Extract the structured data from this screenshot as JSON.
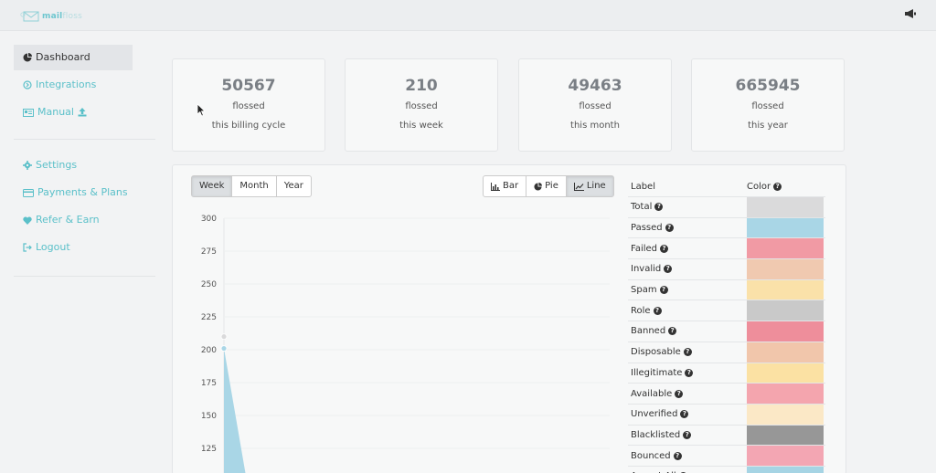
{
  "app": {
    "logo_brand": "mail",
    "logo_suffix": "floss"
  },
  "sidebar": {
    "items": [
      {
        "label": "Dashboard",
        "icon": "pie-chart-icon"
      },
      {
        "label": "Integrations",
        "icon": "circle-arrow-icon"
      },
      {
        "label": "Manual",
        "icon": "upload-icon"
      }
    ],
    "items2": [
      {
        "label": "Settings",
        "icon": "gear-icon"
      },
      {
        "label": "Payments & Plans",
        "icon": "credit-card-icon"
      },
      {
        "label": "Refer & Earn",
        "icon": "heart-icon"
      },
      {
        "label": "Logout",
        "icon": "logout-icon"
      }
    ]
  },
  "cards": [
    {
      "value": "50567",
      "line1": "flossed",
      "line2": "this billing cycle"
    },
    {
      "value": "210",
      "line1": "flossed",
      "line2": "this week"
    },
    {
      "value": "49463",
      "line1": "flossed",
      "line2": "this month"
    },
    {
      "value": "665945",
      "line1": "flossed",
      "line2": "this year"
    }
  ],
  "period_buttons": {
    "week": "Week",
    "month": "Month",
    "year": "Year",
    "active": "Week"
  },
  "chart_type_buttons": {
    "bar": "Bar",
    "pie": "Pie",
    "line": "Line",
    "active": "Line"
  },
  "legend": {
    "label_header": "Label",
    "color_header": "Color",
    "rows": [
      {
        "label": "Total",
        "color": "#dadadb"
      },
      {
        "label": "Passed",
        "color": "#a9d6e6"
      },
      {
        "label": "Failed",
        "color": "#f19aa4"
      },
      {
        "label": "Invalid",
        "color": "#f0c9b0"
      },
      {
        "label": "Spam",
        "color": "#fae1a9"
      },
      {
        "label": "Role",
        "color": "#c9c9c9"
      },
      {
        "label": "Banned",
        "color": "#ee8e9b"
      },
      {
        "label": "Disposable",
        "color": "#f1c6ab"
      },
      {
        "label": "Illegitimate",
        "color": "#fbe1a3"
      },
      {
        "label": "Available",
        "color": "#f4a5ae"
      },
      {
        "label": "Unverified",
        "color": "#fbe8c6"
      },
      {
        "label": "Blacklisted",
        "color": "#979797"
      },
      {
        "label": "Bounced",
        "color": "#f3a6b3"
      },
      {
        "label": "Accept All",
        "color": "#a6d4e4"
      }
    ]
  },
  "chart_data": {
    "type": "line",
    "y_ticks": [
      300,
      275,
      250,
      225,
      200,
      175,
      150,
      125
    ],
    "ylim": [
      100,
      300
    ],
    "visible_points": [
      {
        "series": "Total",
        "y": 210,
        "color": "#dadadb"
      },
      {
        "series": "Passed",
        "y": 201,
        "color": "#a9d6e6"
      }
    ]
  }
}
